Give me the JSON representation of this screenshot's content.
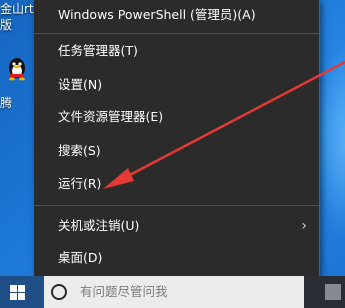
{
  "desktop": {
    "icon_labels": [
      "金山rt",
      "版",
      "腾"
    ]
  },
  "menu": {
    "items": [
      {
        "label": "Windows PowerShell (管理员)(A)"
      },
      {
        "label": "任务管理器(T)"
      },
      {
        "label": "设置(N)"
      },
      {
        "label": "文件资源管理器(E)"
      },
      {
        "label": "搜索(S)"
      },
      {
        "label": "运行(R)"
      },
      {
        "label": "关机或注销(U)",
        "submenu": true
      },
      {
        "label": "桌面(D)"
      }
    ],
    "submenu_glyph": "›"
  },
  "taskbar": {
    "search_placeholder": "有问题尽管问我",
    "start_icon": "windows-logo-icon",
    "search_icon": "cortana-circle-icon"
  },
  "annotation": {
    "color": "#e53935",
    "points_to": "运行(R)"
  },
  "colors": {
    "menu_bg": "#2b2b2b",
    "desktop": "#1e7ad8",
    "arrow": "#e53935"
  }
}
